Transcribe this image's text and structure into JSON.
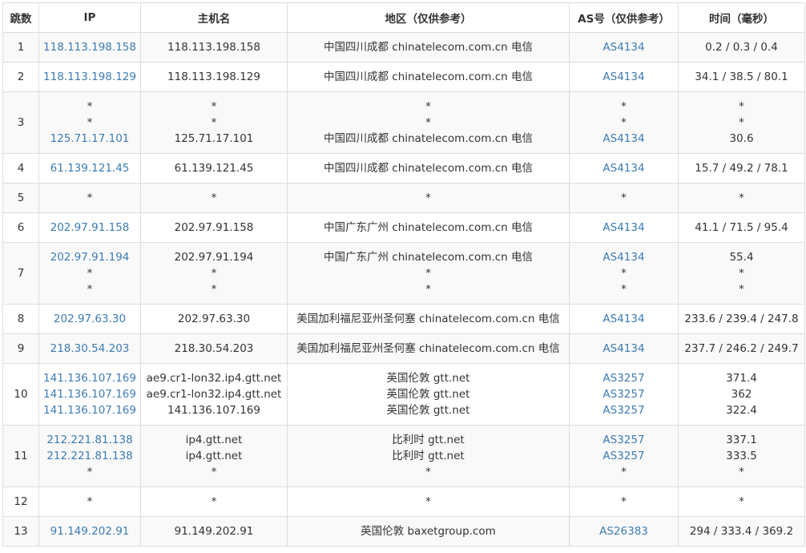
{
  "columns": {
    "hop": "跳数",
    "ip": "IP",
    "host": "主机名",
    "region": "地区（仅供参考）",
    "as": "AS号（仅供参考）",
    "time": "时间（毫秒）"
  },
  "rows": [
    {
      "hop": "1",
      "lines": [
        {
          "ip": "118.113.198.158",
          "host": "118.113.198.158",
          "region": "中国四川成都 chinatelecom.com.cn 电信",
          "as": "AS4134",
          "time": "0.2 / 0.3 / 0.4"
        }
      ]
    },
    {
      "hop": "2",
      "lines": [
        {
          "ip": "118.113.198.129",
          "host": "118.113.198.129",
          "region": "中国四川成都 chinatelecom.com.cn 电信",
          "as": "AS4134",
          "time": "34.1 / 38.5 / 80.1"
        }
      ]
    },
    {
      "hop": "3",
      "lines": [
        {
          "ip": "*",
          "host": "*",
          "region": "*",
          "as": "*",
          "time": "*"
        },
        {
          "ip": "*",
          "host": "*",
          "region": "*",
          "as": "*",
          "time": "*"
        },
        {
          "ip": "125.71.17.101",
          "host": "125.71.17.101",
          "region": "中国四川成都 chinatelecom.com.cn 电信",
          "as": "AS4134",
          "time": "30.6"
        }
      ]
    },
    {
      "hop": "4",
      "lines": [
        {
          "ip": "61.139.121.45",
          "host": "61.139.121.45",
          "region": "中国四川成都 chinatelecom.com.cn 电信",
          "as": "AS4134",
          "time": "15.7 / 49.2 / 78.1"
        }
      ]
    },
    {
      "hop": "5",
      "lines": [
        {
          "ip": "*",
          "host": "*",
          "region": "*",
          "as": "*",
          "time": "*"
        }
      ]
    },
    {
      "hop": "6",
      "lines": [
        {
          "ip": "202.97.91.158",
          "host": "202.97.91.158",
          "region": "中国广东广州 chinatelecom.com.cn 电信",
          "as": "AS4134",
          "time": "41.1 / 71.5 / 95.4"
        }
      ]
    },
    {
      "hop": "7",
      "lines": [
        {
          "ip": "202.97.91.194",
          "host": "202.97.91.194",
          "region": "中国广东广州 chinatelecom.com.cn 电信",
          "as": "AS4134",
          "time": "55.4"
        },
        {
          "ip": "*",
          "host": "*",
          "region": "*",
          "as": "*",
          "time": "*"
        },
        {
          "ip": "*",
          "host": "*",
          "region": "*",
          "as": "*",
          "time": "*"
        }
      ]
    },
    {
      "hop": "8",
      "lines": [
        {
          "ip": "202.97.63.30",
          "host": "202.97.63.30",
          "region": "美国加利福尼亚州圣何塞 chinatelecom.com.cn 电信",
          "as": "AS4134",
          "time": "233.6 / 239.4 / 247.8"
        }
      ]
    },
    {
      "hop": "9",
      "lines": [
        {
          "ip": "218.30.54.203",
          "host": "218.30.54.203",
          "region": "美国加利福尼亚州圣何塞 chinatelecom.com.cn 电信",
          "as": "AS4134",
          "time": "237.7 / 246.2 / 249.7"
        }
      ]
    },
    {
      "hop": "10",
      "lines": [
        {
          "ip": "141.136.107.169",
          "host": "ae9.cr1-lon32.ip4.gtt.net",
          "region": "英国伦敦 gtt.net",
          "as": "AS3257",
          "time": "371.4"
        },
        {
          "ip": "141.136.107.169",
          "host": "ae9.cr1-lon32.ip4.gtt.net",
          "region": "英国伦敦 gtt.net",
          "as": "AS3257",
          "time": "362"
        },
        {
          "ip": "141.136.107.169",
          "host": "141.136.107.169",
          "region": "英国伦敦 gtt.net",
          "as": "AS3257",
          "time": "322.4"
        }
      ]
    },
    {
      "hop": "11",
      "lines": [
        {
          "ip": "212.221.81.138",
          "host": "ip4.gtt.net",
          "region": "比利时 gtt.net",
          "as": "AS3257",
          "time": "337.1"
        },
        {
          "ip": "212.221.81.138",
          "host": "ip4.gtt.net",
          "region": "比利时 gtt.net",
          "as": "AS3257",
          "time": "333.5"
        },
        {
          "ip": "*",
          "host": "*",
          "region": "*",
          "as": "*",
          "time": "*"
        }
      ]
    },
    {
      "hop": "12",
      "lines": [
        {
          "ip": "*",
          "host": "*",
          "region": "*",
          "as": "*",
          "time": "*"
        }
      ]
    },
    {
      "hop": "13",
      "lines": [
        {
          "ip": "91.149.202.91",
          "host": "91.149.202.91",
          "region": "英国伦敦 baxetgroup.com",
          "as": "AS26383",
          "time": "294 / 333.4 / 369.2"
        }
      ]
    }
  ]
}
